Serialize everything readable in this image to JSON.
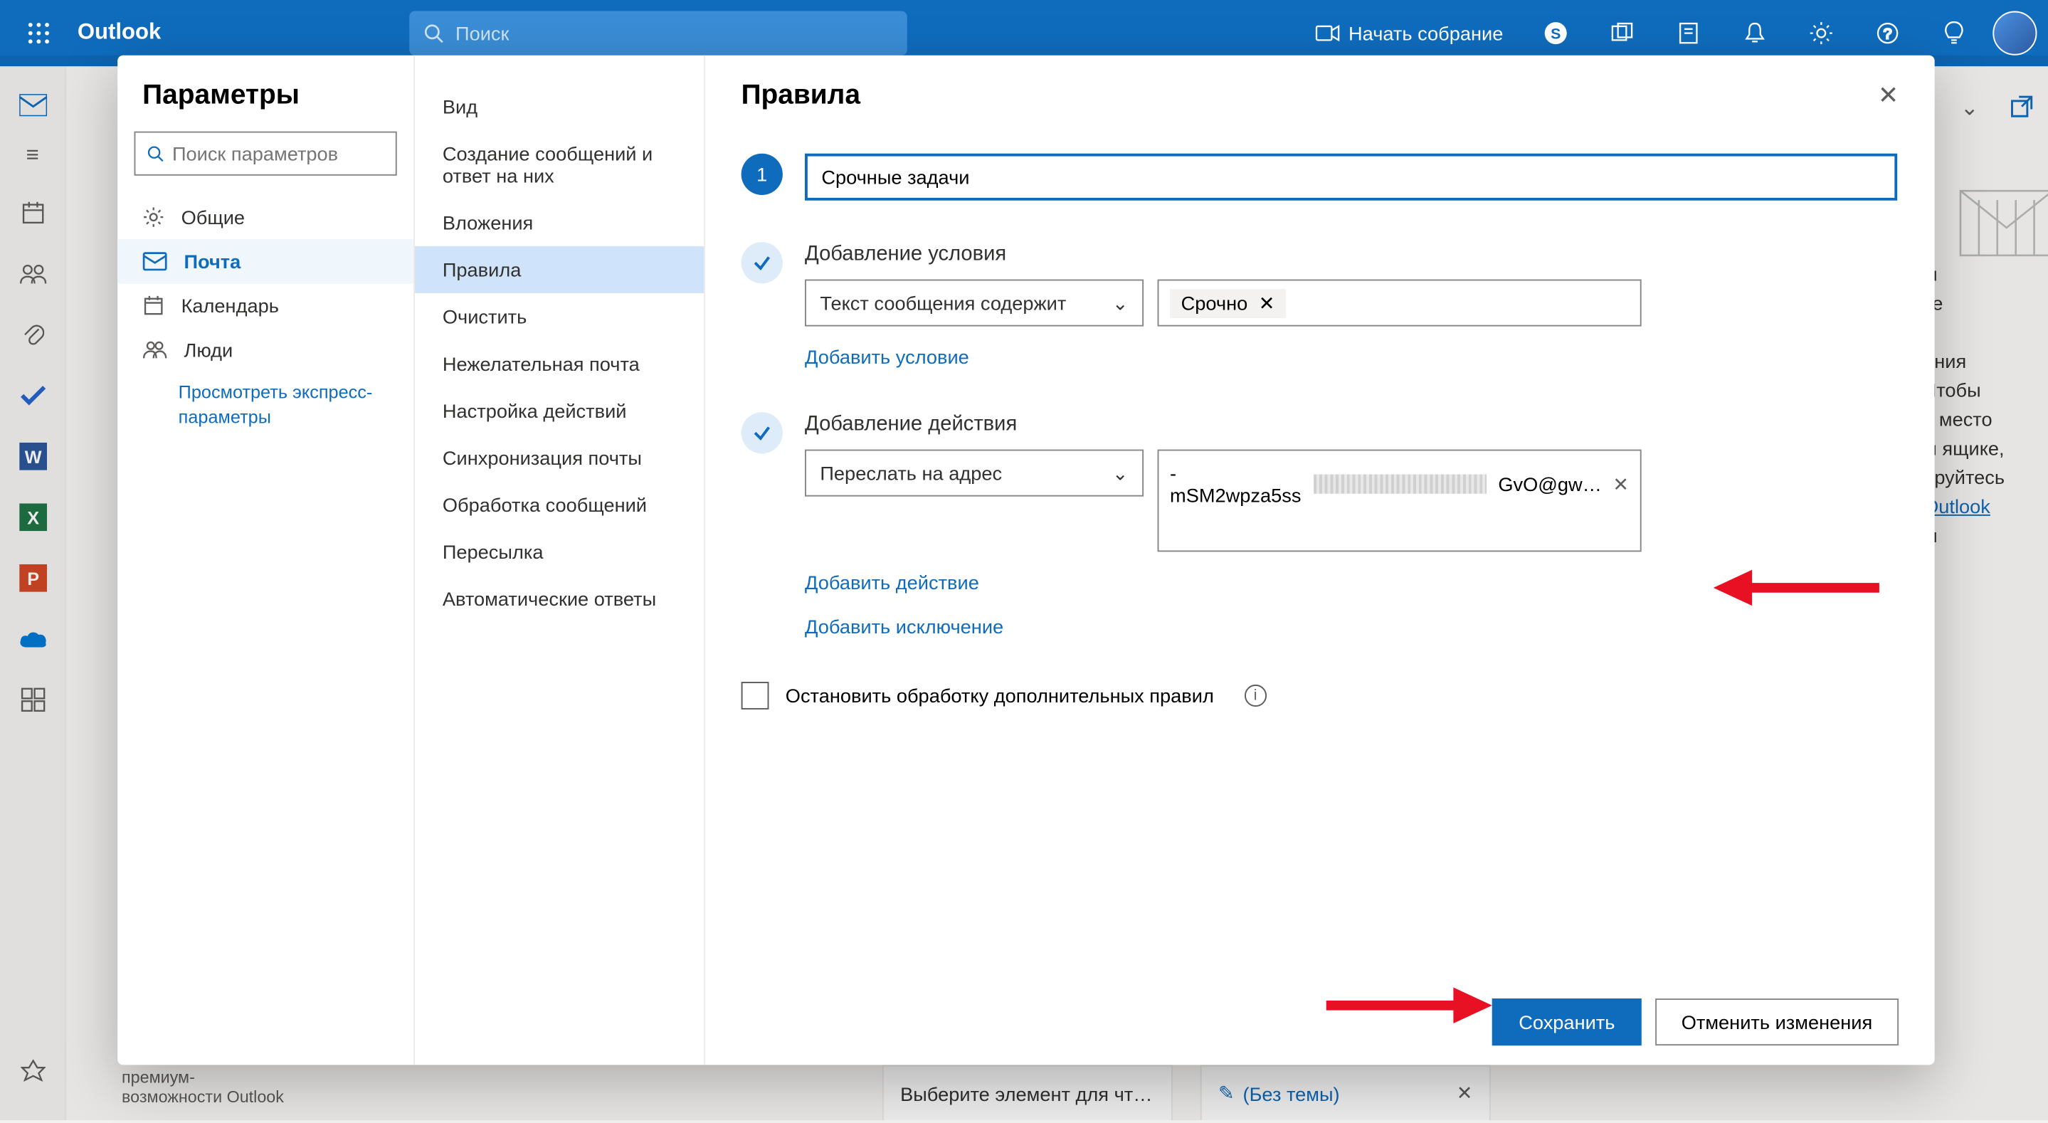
{
  "header": {
    "brand": "Outlook",
    "search_placeholder": "Поиск",
    "meet_label": "Начать собрание"
  },
  "shell": {
    "premium_hint": "премиум-\nвозможности Outlook",
    "tab_reader": "Выберите элемент для чт…",
    "tab_nosubject": "(Без темы)",
    "right_text": "ы\nте\n\nания\nЧтобы\nь место\nм ящике,\nируйтесь",
    "right_link": "Outlook",
    "right_tail": "ы"
  },
  "dialog": {
    "title_col1": "Параметры",
    "search_placeholder": "Поиск параметров",
    "categories": [
      {
        "id": "general",
        "label": "Общие"
      },
      {
        "id": "mail",
        "label": "Почта"
      },
      {
        "id": "calendar",
        "label": "Календарь"
      },
      {
        "id": "people",
        "label": "Люди"
      }
    ],
    "quick_settings_link": "Просмотреть экспресс-параметры",
    "col2": [
      {
        "id": "layout",
        "label": "Вид"
      },
      {
        "id": "compose",
        "label": "Создание сообщений и ответ на них"
      },
      {
        "id": "attachments",
        "label": "Вложения"
      },
      {
        "id": "rules",
        "label": "Правила"
      },
      {
        "id": "sweep",
        "label": "Очистить"
      },
      {
        "id": "junk",
        "label": "Нежелательная почта"
      },
      {
        "id": "actions",
        "label": "Настройка действий"
      },
      {
        "id": "sync",
        "label": "Синхронизация почты"
      },
      {
        "id": "handling",
        "label": "Обработка сообщений"
      },
      {
        "id": "forwarding",
        "label": "Пересылка"
      },
      {
        "id": "auto",
        "label": "Автоматические ответы"
      }
    ],
    "content": {
      "title": "Правила",
      "step_num": "1",
      "rule_name": "Срочные задачи",
      "add_condition_label": "Добавление условия",
      "condition_dropdown": "Текст сообщения содержит",
      "condition_tag": "Срочно",
      "add_condition_link": "Добавить условие",
      "add_action_label": "Добавление действия",
      "action_dropdown": "Переслать на адрес",
      "email_left": "-mSM2wpza5ss",
      "email_right": "GvO@gw…",
      "add_action_link": "Добавить действие",
      "add_exception_link": "Добавить исключение",
      "stop_processing_label": "Остановить обработку дополнительных правил",
      "save_label": "Сохранить",
      "cancel_label": "Отменить изменения"
    }
  }
}
